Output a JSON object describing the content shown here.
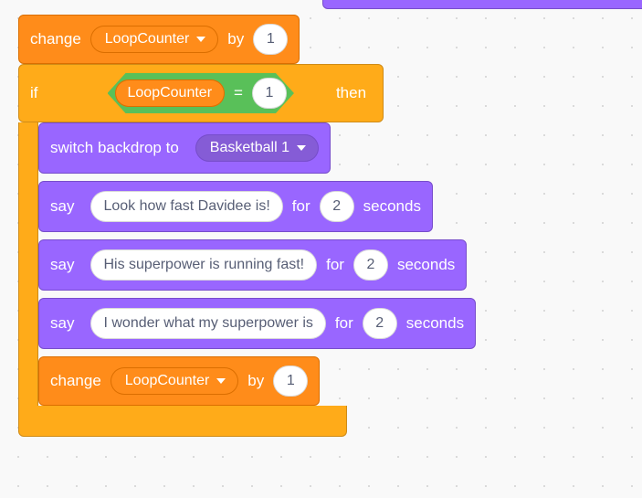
{
  "topChange": {
    "label": "change",
    "var": "LoopCounter",
    "byLabel": "by",
    "value": "1"
  },
  "ifBlock": {
    "ifLabel": "if",
    "thenLabel": "then",
    "condition": {
      "var": "LoopCounter",
      "op": "=",
      "value": "1"
    }
  },
  "switchBackdrop": {
    "label": "switch backdrop to",
    "value": "Basketball 1"
  },
  "say1": {
    "label": "say",
    "text": "Look how fast Davidee is!",
    "forLabel": "for",
    "secs": "2",
    "secLabel": "seconds"
  },
  "say2": {
    "label": "say",
    "text": "His superpower is running fast!",
    "forLabel": "for",
    "secs": "2",
    "secLabel": "seconds"
  },
  "say3": {
    "label": "say",
    "text": "I wonder what my superpower is",
    "forLabel": "for",
    "secs": "2",
    "secLabel": "seconds"
  },
  "innerChange": {
    "label": "change",
    "var": "LoopCounter",
    "byLabel": "by",
    "value": "1"
  }
}
